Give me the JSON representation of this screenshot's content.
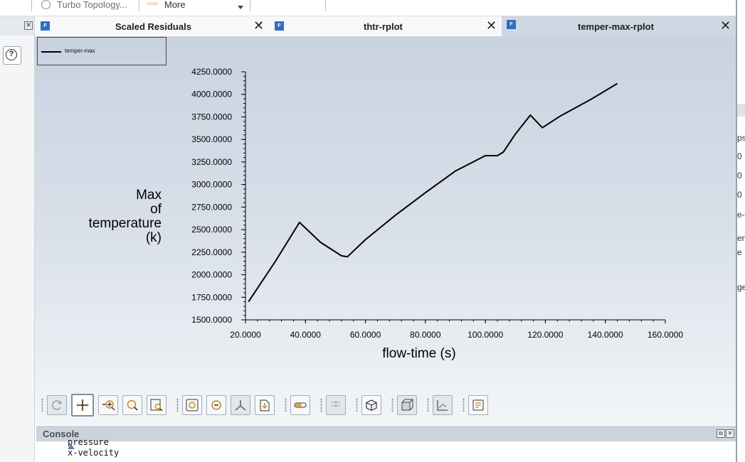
{
  "top_strip": {
    "turbo_label": "Turbo Topology...",
    "more_label": "More"
  },
  "tabs": [
    {
      "label": "Scaled Residuals",
      "icon": "F"
    },
    {
      "label": "thtr-rplot",
      "icon": "F"
    },
    {
      "label": "temper-max-rplot",
      "icon": "F"
    }
  ],
  "legend": {
    "label": "temper-max"
  },
  "ylabel_lines": [
    "Max",
    "of",
    "temperature",
    "(k)"
  ],
  "xlabel": "flow-time (s)",
  "chart_data": {
    "type": "line",
    "xlabel": "flow-time (s)",
    "ylabel": "Max of temperature (k)",
    "xlim": [
      20,
      160
    ],
    "ylim": [
      1500,
      4250
    ],
    "xticks": [
      "20.0000",
      "40.0000",
      "60.0000",
      "80.0000",
      "100.0000",
      "120.0000",
      "140.0000",
      "160.0000"
    ],
    "yticks": [
      "1500.0000",
      "1750.0000",
      "2000.0000",
      "2250.0000",
      "2500.0000",
      "2750.0000",
      "3000.0000",
      "3250.0000",
      "3500.0000",
      "3750.0000",
      "4000.0000",
      "4250.0000"
    ],
    "series": [
      {
        "name": "temper-max",
        "x": [
          21,
          30,
          38,
          45,
          52,
          54,
          60,
          70,
          80,
          90,
          100,
          104,
          106,
          110,
          115,
          119,
          125,
          135,
          144
        ],
        "y": [
          1700,
          2150,
          2580,
          2360,
          2210,
          2200,
          2390,
          2660,
          2910,
          3150,
          3320,
          3320,
          3360,
          3560,
          3770,
          3630,
          3760,
          3940,
          4120
        ]
      }
    ]
  },
  "console": {
    "title": "Console",
    "lines": [
      "pressure",
      "x-velocity"
    ]
  },
  "right_panel_fragments": [
    "ps",
    "0",
    "0",
    "0",
    "e-",
    "en",
    "e",
    "ge"
  ],
  "colors": {
    "accent": "#2f6ec7",
    "plot_bg_top": "#c9d2e0",
    "line": "#000000"
  }
}
